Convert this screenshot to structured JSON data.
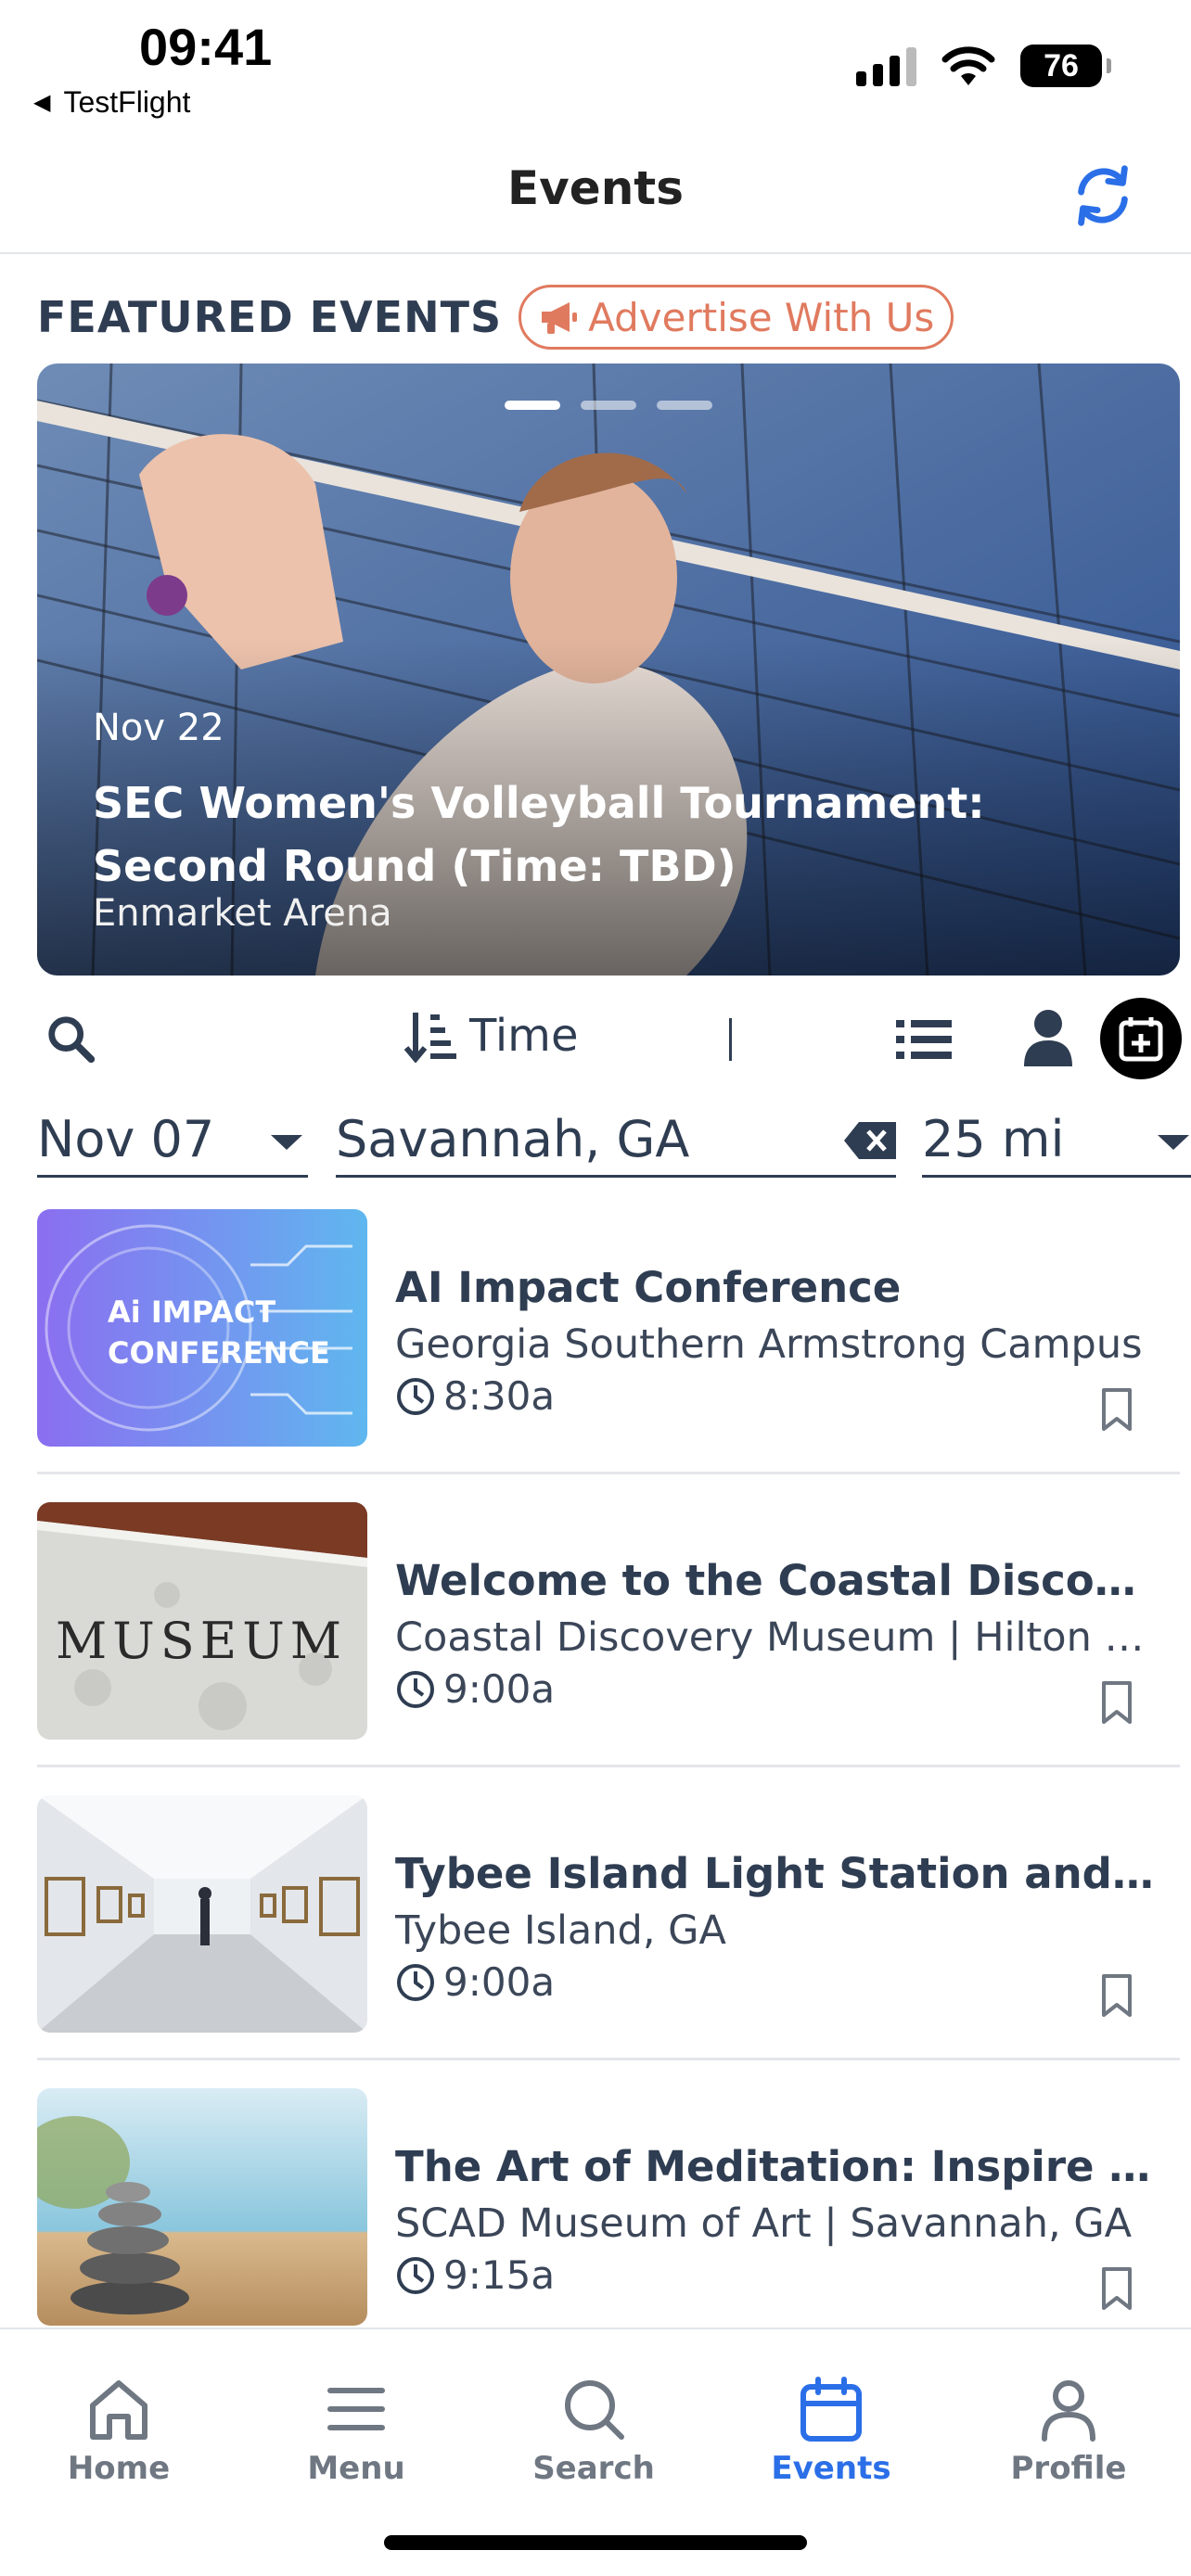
{
  "status_bar": {
    "time": "09:41",
    "back_app": "TestFlight",
    "battery": "76"
  },
  "header": {
    "title": "Events"
  },
  "featured": {
    "title": "FEATURED EVENTS",
    "advertise_label": "Advertise With Us",
    "active_slide": 1,
    "slide_count": 3,
    "slide": {
      "date": "Nov 22",
      "title": "SEC Women's Volleyball Tournament: Second Round (Time: TBD)",
      "venue": "Enmarket Arena"
    }
  },
  "toolbar": {
    "sort_label": "Time",
    "divider": "|"
  },
  "filters": {
    "date": "Nov 07",
    "location": "Savannah, GA",
    "distance": "25 mi"
  },
  "events": [
    {
      "title": "AI Impact Conference",
      "location": "Georgia Southern Armstrong Campus",
      "time": "8:30a",
      "thumb_text_1": "Ai IMPACT",
      "thumb_text_2": "CONFERENCE"
    },
    {
      "title": "Welcome to the Coastal Discovery Museum",
      "location": "Coastal Discovery Museum | Hilton Head Island, SC",
      "time": "9:00a",
      "thumb_text_1": "MUSEUM"
    },
    {
      "title": "Tybee Island Light Station and Museum",
      "location": "Tybee Island, GA",
      "time": "9:00a"
    },
    {
      "title": "The Art of Meditation: Inspire Your Practice",
      "location": "SCAD Museum of Art | Savannah, GA",
      "time": "9:15a"
    }
  ],
  "tabs": [
    {
      "label": "Home",
      "icon": "home-icon"
    },
    {
      "label": "Menu",
      "icon": "menu-icon"
    },
    {
      "label": "Search",
      "icon": "search-icon"
    },
    {
      "label": "Events",
      "icon": "calendar-icon",
      "active": true
    },
    {
      "label": "Profile",
      "icon": "profile-icon"
    }
  ],
  "colors": {
    "accent": "#2b6fe8",
    "advertise": "#e07a5f",
    "text_dark": "#2f3d52",
    "tab_inactive": "#6f7782"
  }
}
